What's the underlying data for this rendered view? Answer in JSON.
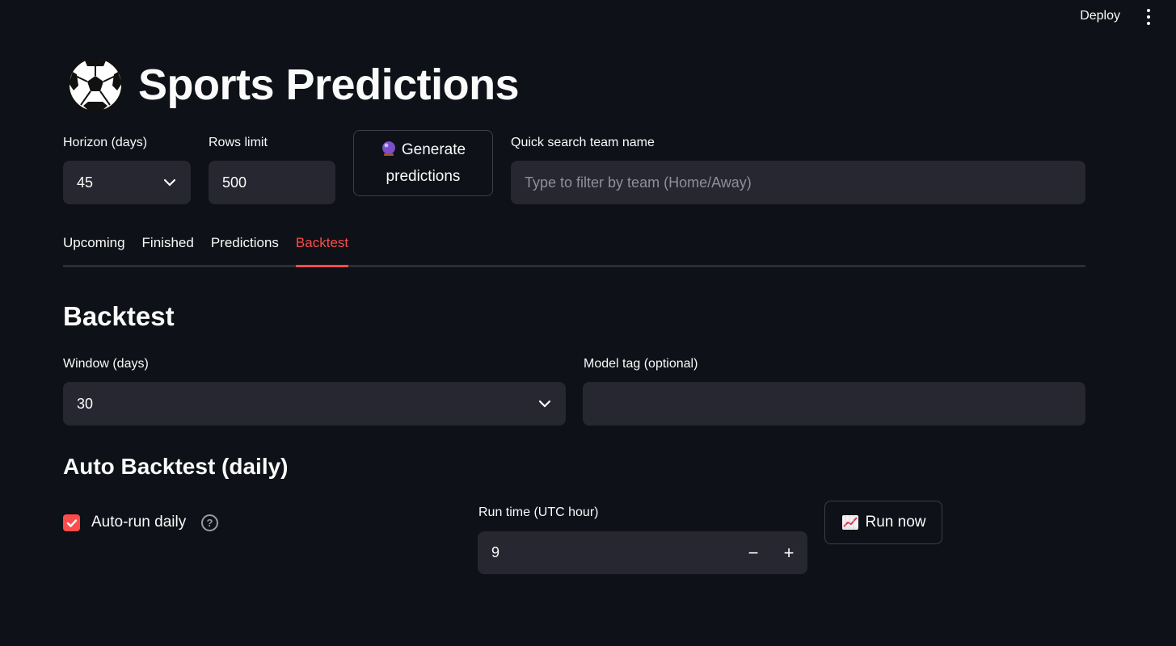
{
  "topbar": {
    "deploy_label": "Deploy",
    "menu_icon": "kebab-menu-icon"
  },
  "header": {
    "icon": "soccer-ball-icon",
    "title": "Sports Predictions"
  },
  "controls": {
    "horizon": {
      "label": "Horizon (days)",
      "value": "45"
    },
    "rows_limit": {
      "label": "Rows limit",
      "value": "500"
    },
    "generate": {
      "icon": "crystal-ball-icon",
      "line1": "Generate",
      "line2": "predictions"
    },
    "search": {
      "label": "Quick search team name",
      "placeholder": "Type to filter by team (Home/Away)"
    }
  },
  "tabs": [
    {
      "label": "Upcoming"
    },
    {
      "label": "Finished"
    },
    {
      "label": "Predictions"
    },
    {
      "label": "Backtest",
      "active": true
    }
  ],
  "backtest": {
    "heading": "Backtest",
    "window": {
      "label": "Window (days)",
      "value": "30"
    },
    "model_tag": {
      "label": "Model tag (optional)",
      "value": ""
    }
  },
  "auto_backtest": {
    "heading": "Auto Backtest (daily)",
    "checkbox": {
      "label": "Auto-run daily",
      "checked": true
    },
    "run_time": {
      "label": "Run time (UTC hour)",
      "value": "9",
      "minus": "−",
      "plus": "+"
    },
    "run_now": {
      "icon": "chart-increasing-icon",
      "label": "Run now"
    }
  },
  "colors": {
    "accent": "#ff4b4b",
    "background": "#0e1117",
    "input_bg": "#262730"
  }
}
